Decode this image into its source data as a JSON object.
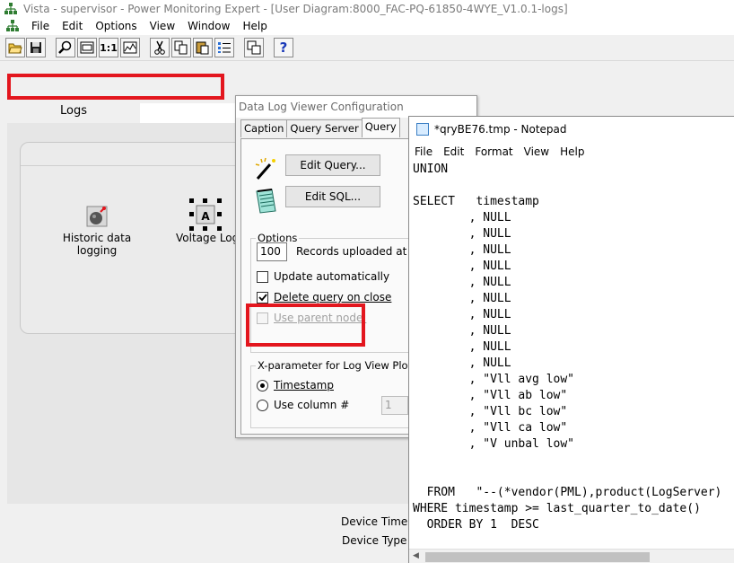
{
  "window": {
    "title": "Vista - supervisor - Power Monitoring Expert - [User Diagram:8000_FAC-PQ-61850-4WYE_V1.0.1-logs]"
  },
  "menubar": {
    "items": [
      "File",
      "Edit",
      "Options",
      "View",
      "Window",
      "Help"
    ]
  },
  "toolbar": {
    "buttons": [
      "open-icon",
      "save-icon",
      "zoom-icon",
      "fit-icon",
      "actual-size-icon",
      "chart-icon",
      "cut-icon",
      "copy-icon",
      "paste-icon",
      "properties-icon",
      "grid-icon",
      "help-icon"
    ],
    "actual_size_label": "1:1",
    "help_label": "?"
  },
  "diagram": {
    "tab_label": "Logs",
    "nodes": [
      {
        "label": "Historic data logging",
        "icon": "log-device-icon"
      },
      {
        "label": "Voltage Log",
        "icon": "voltage-log-icon"
      }
    ],
    "device_time_label": "Device Time",
    "device_type_label": "Device Type"
  },
  "dialog": {
    "title": "Data Log Viewer Configuration",
    "tabs": [
      "Caption",
      "Query Server",
      "Query"
    ],
    "active_tab": "Query",
    "edit_query_label": "Edit Query...",
    "edit_sql_label": "Edit SQL...",
    "options_label": "Options",
    "records_value": "100",
    "records_label": "Records uploaded at a time",
    "update_auto_label": "Update automatically",
    "update_auto_checked": false,
    "delete_query_label": "Delete query on close",
    "delete_query_checked": true,
    "use_parent_label": "Use parent node:",
    "use_parent_checked": false,
    "xparam_label": "X-parameter for Log View Plotter",
    "timestamp_label": "Timestamp",
    "use_column_label": "Use column #",
    "column_value": "1"
  },
  "notepad": {
    "title": "*qryBE76.tmp - Notepad",
    "menu": [
      "File",
      "Edit",
      "Format",
      "View",
      "Help"
    ],
    "lines": [
      "UNION",
      "",
      "SELECT   timestamp",
      "        , NULL",
      "        , NULL",
      "        , NULL",
      "        , NULL",
      "        , NULL",
      "        , NULL",
      "        , NULL",
      "        , NULL",
      "        , NULL",
      "        , NULL",
      "        , \"Vll avg low\"",
      "        , \"Vll ab low\"",
      "        , \"Vll bc low\"",
      "        , \"Vll ca low\"",
      "        , \"V unbal low\"",
      "",
      "",
      "  FROM   \"--(*vendor(PML),product(LogServer)",
      "WHERE timestamp >= last_quarter_to_date()",
      "  ORDER BY 1  DESC"
    ]
  },
  "colors": {
    "highlight_red": "#e3161e",
    "title_text_gray": "#7a7a7a"
  }
}
